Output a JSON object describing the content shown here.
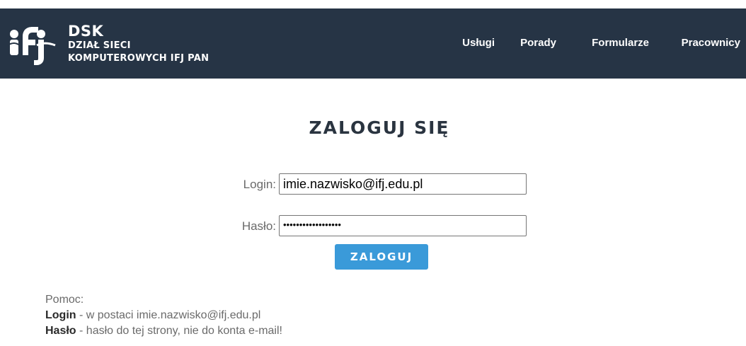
{
  "header": {
    "brand_title": "DSK",
    "brand_line1": "DZIAŁ SIECI",
    "brand_line2": "KOMPUTEROWYCH IFJ PAN",
    "logo_icon": "ifj-logo-icon",
    "nav": [
      {
        "label": "Usługi"
      },
      {
        "label": "Porady"
      },
      {
        "label": "Formularze"
      },
      {
        "label": "Pracownicy"
      }
    ]
  },
  "login": {
    "heading": "ZALOGUJ SIĘ",
    "login_label": "Login:",
    "login_value": "imie.nazwisko@ifj.edu.pl",
    "password_label": "Hasło:",
    "password_value": "••••••••••••••••••",
    "submit_label": "ZALOGUJ"
  },
  "help": {
    "title": "Pomoc:",
    "login_term": "Login",
    "login_desc": " - w postaci imie.nazwisko@ifj.edu.pl",
    "password_term": "Hasło",
    "password_desc": " - hasło do tej strony, nie do konta e-mail!"
  },
  "colors": {
    "header_bg": "#263445",
    "button_bg": "#3a9ad9",
    "heading_text": "#2a3440"
  }
}
